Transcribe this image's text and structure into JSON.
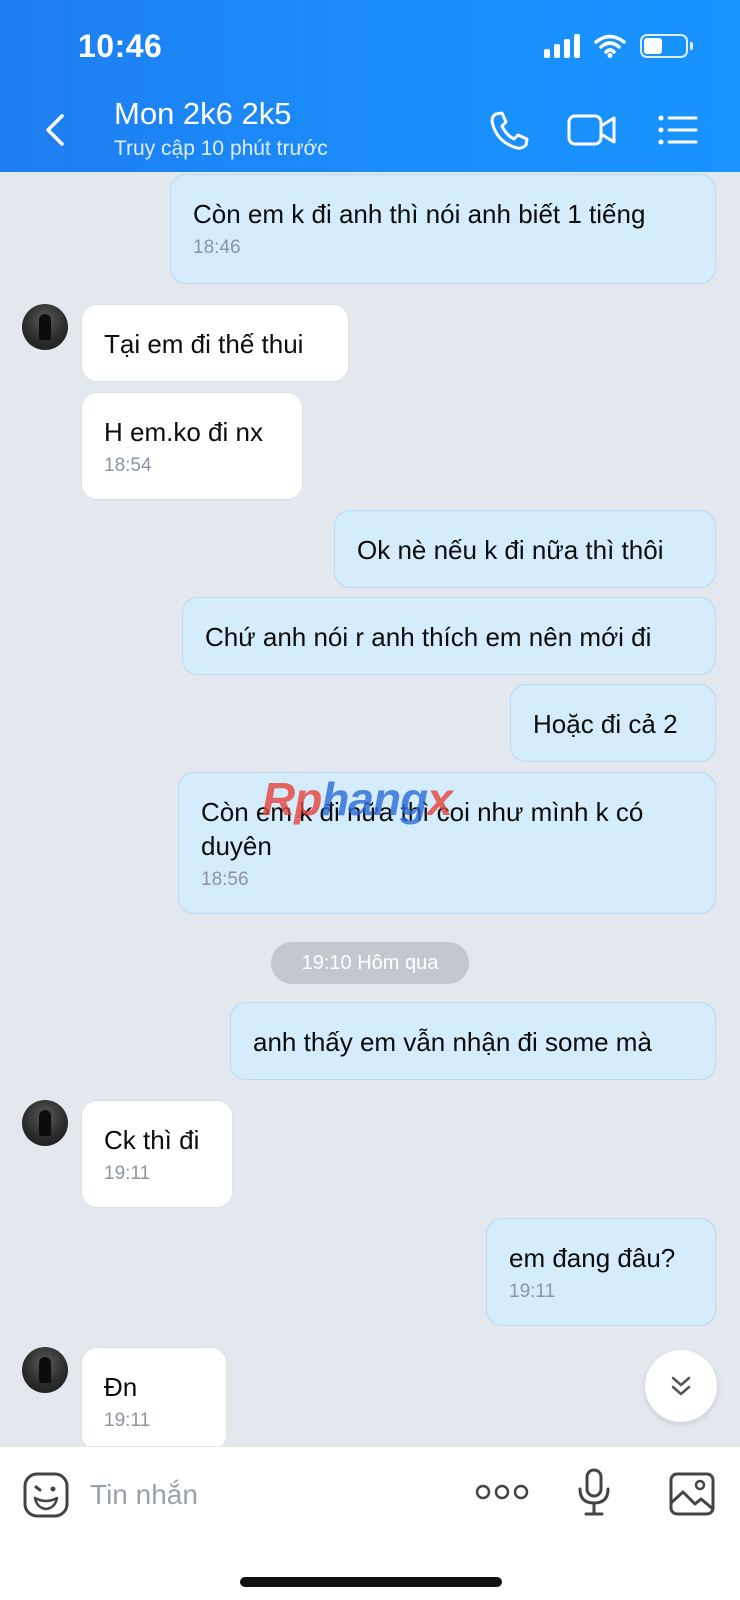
{
  "status_bar": {
    "time": "10:46",
    "battery_level_pct": 45
  },
  "header": {
    "title": "Mon 2k6 2k5",
    "subtitle": "Truy cập 10 phút trước",
    "icons": [
      "back-icon",
      "phone-icon",
      "video-call-icon",
      "menu-icon"
    ]
  },
  "messages": [
    {
      "side": "me",
      "text": "Còn em k đi anh thì nói anh biết 1 tiếng",
      "time": "18:46"
    },
    {
      "side": "them",
      "text": "Tại em đi thế thui",
      "time": ""
    },
    {
      "side": "them",
      "text": "H em.ko đi nx",
      "time": "18:54"
    },
    {
      "side": "me",
      "text": "Ok nè nếu k đi nữa thì thôi",
      "time": ""
    },
    {
      "side": "me",
      "text": "Chứ anh nói r anh thích em nên mới đi",
      "time": ""
    },
    {
      "side": "me",
      "text": "Hoặc đi cả 2",
      "time": ""
    },
    {
      "side": "me",
      "text": "Còn em k đi nữa thì coi như mình k có duyên",
      "time": "18:56"
    },
    {
      "side": "me",
      "text": "anh thấy em vẫn nhận đi some mà",
      "time": ""
    },
    {
      "side": "them",
      "text": "Ck thì đi",
      "time": "19:11"
    },
    {
      "side": "me",
      "text": "em đang đâu?",
      "time": "19:11"
    },
    {
      "side": "them",
      "text": "Đn",
      "time": "19:11"
    }
  ],
  "date_separator": "19:10 Hôm qua",
  "watermark": {
    "part1": "Rp",
    "part2": "hang",
    "part3": "x"
  },
  "composer": {
    "placeholder": "Tin nhắn",
    "icons": [
      "emoji-icon",
      "more-icon",
      "microphone-icon",
      "image-icon"
    ]
  },
  "colors": {
    "header": "#1a8ffc",
    "my_bubble": "#d5ecfd",
    "their_bubble": "#ffffff",
    "background": "#e3e7ee"
  }
}
